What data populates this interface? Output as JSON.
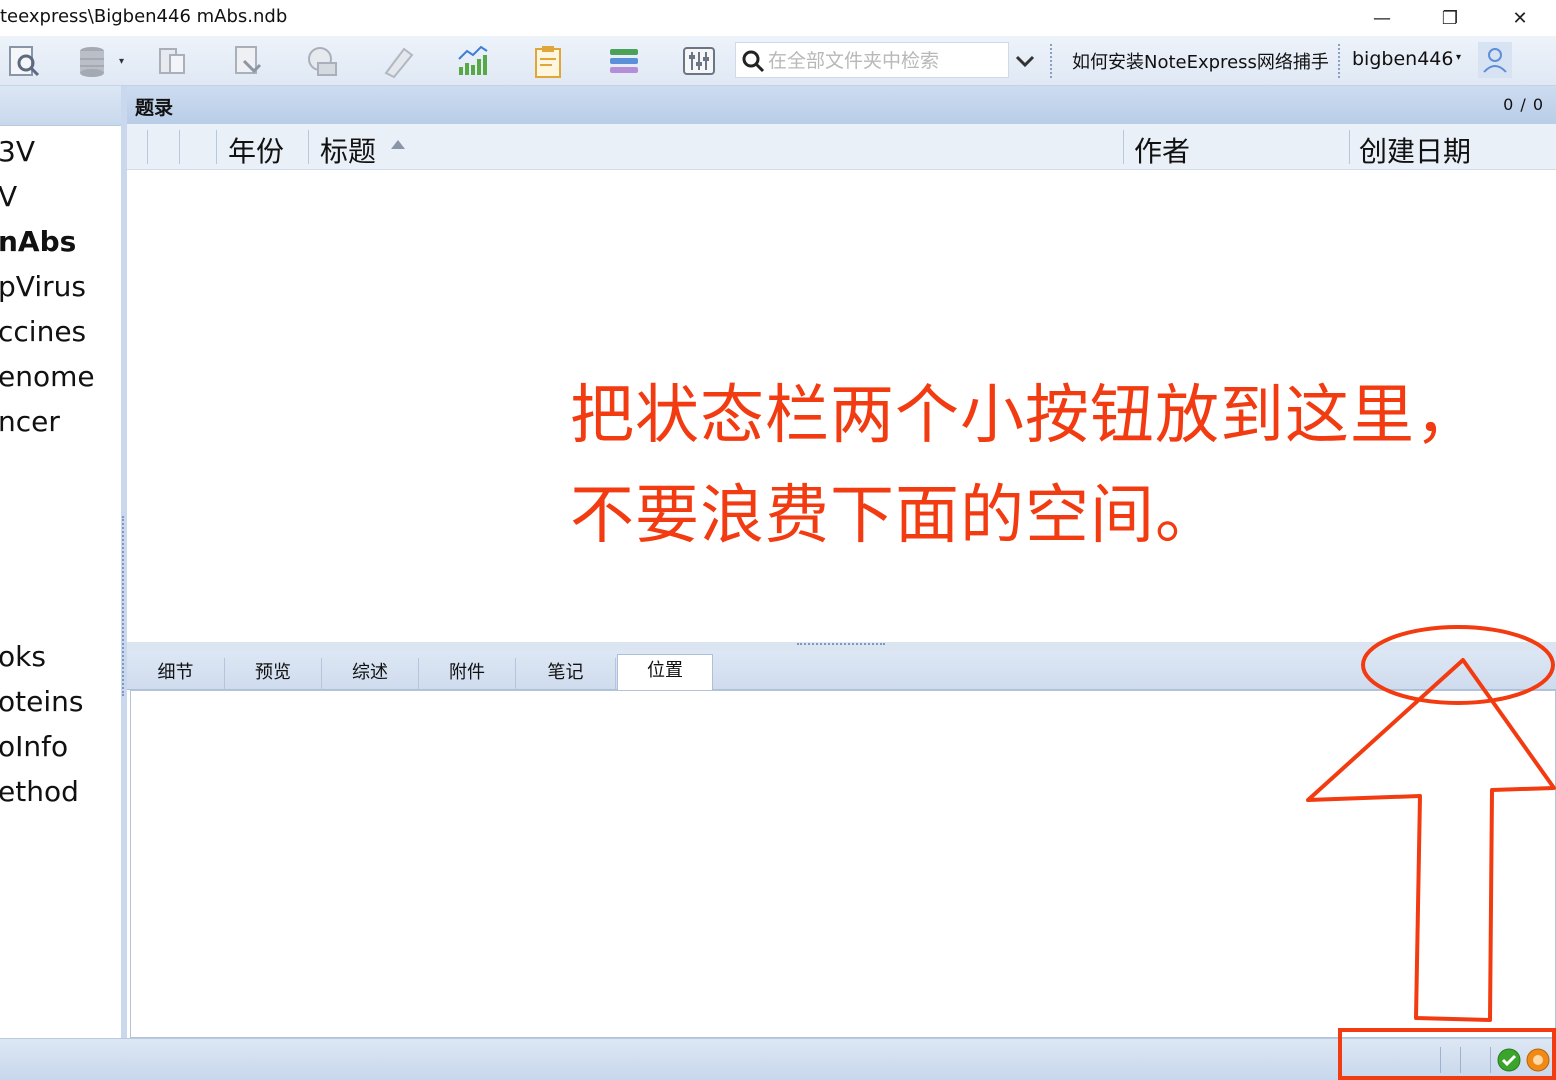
{
  "window": {
    "title": "teexpress\\Bigben446 mAbs.ndb",
    "minimize": "—",
    "restore": "❐",
    "close": "✕"
  },
  "toolbar": {
    "search_placeholder": "在全部文件夹中检索",
    "help_link": "如何安装NoteExpress网络捕手",
    "user": "bigben446",
    "caret": "▾",
    "icons": [
      "search-doc-icon",
      "database-icon",
      "export-icon",
      "import-icon",
      "online-search-icon",
      "tag-icon",
      "chart-icon",
      "clipboard-icon",
      "layers-icon",
      "settings-icon"
    ],
    "accent": "#3b7dd8"
  },
  "sidebar": {
    "folders": [
      {
        "label": "3V",
        "bold": false
      },
      {
        "label": "V",
        "bold": false
      },
      {
        "label": "nAbs",
        "bold": true
      },
      {
        "label": "pVirus",
        "bold": false
      },
      {
        "label": "ccines",
        "bold": false
      },
      {
        "label": "enome",
        "bold": false
      },
      {
        "label": "ncer",
        "bold": false
      },
      {
        "label": "oks",
        "bold": false
      },
      {
        "label": "oteins",
        "bold": false
      },
      {
        "label": "oInfo",
        "bold": false
      },
      {
        "label": "ethod",
        "bold": false
      }
    ]
  },
  "list": {
    "title": "题录",
    "count": "0 / 0",
    "columns": {
      "year": "年份",
      "title": "标题",
      "author": "作者",
      "created": "创建日期"
    }
  },
  "tabs": [
    "细节",
    "预览",
    "综述",
    "附件",
    "笔记",
    "位置"
  ],
  "active_tab": "位置",
  "annotation": {
    "line1": "把状态栏两个小按钮放到这里，",
    "line2": "不要浪费下面的空间。",
    "color": "#f23b10"
  },
  "status": {
    "ok_color": "#3aa52a",
    "sync_color": "#f08a14"
  }
}
